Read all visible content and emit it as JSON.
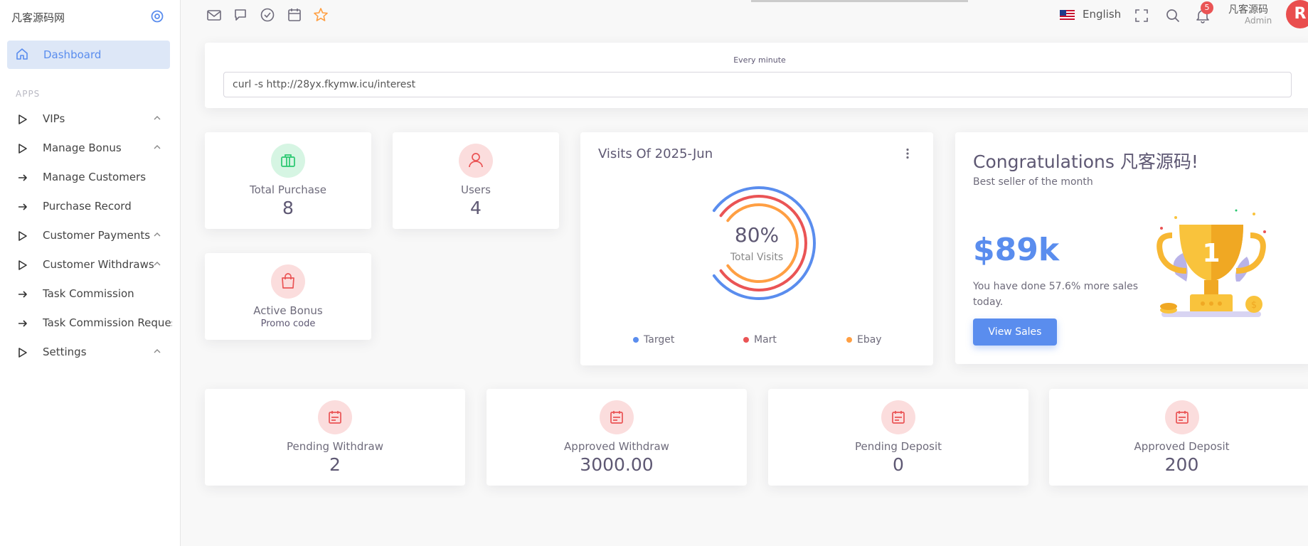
{
  "sidebar": {
    "brand": "凡客源码网",
    "active_item": "Dashboard",
    "section_title": "APPS",
    "items": [
      {
        "label": "VIPs",
        "icon": "play-icon",
        "expandable": true
      },
      {
        "label": "Manage Bonus",
        "icon": "play-icon",
        "expandable": true
      },
      {
        "label": "Manage Customers",
        "icon": "arrow-right-icon",
        "expandable": false
      },
      {
        "label": "Purchase Record",
        "icon": "arrow-right-icon",
        "expandable": false
      },
      {
        "label": "Customer Payments",
        "icon": "play-icon",
        "expandable": true
      },
      {
        "label": "Customer Withdraws",
        "icon": "play-icon",
        "expandable": true
      },
      {
        "label": "Task Commission",
        "icon": "arrow-right-icon",
        "expandable": false
      },
      {
        "label": "Task Commission Request",
        "icon": "arrow-right-icon",
        "expandable": false
      },
      {
        "label": "Settings",
        "icon": "play-icon",
        "expandable": true
      }
    ]
  },
  "topbar": {
    "bookmark_icons": [
      "mail-icon",
      "chat-icon",
      "check-circle-icon",
      "calendar-icon",
      "star-icon"
    ],
    "language": "English",
    "notification_count": "5",
    "user_name": "凡客源码",
    "user_role": "Admin",
    "avatar_letter": "R"
  },
  "cron": {
    "label": "Every minute",
    "command": "curl -s http://28yx.fkymw.icu/interest"
  },
  "stats_top": [
    {
      "label": "Total Purchase",
      "value": "8",
      "icon": "briefcase-icon",
      "color": "#28c76f"
    },
    {
      "label": "Users",
      "value": "4",
      "icon": "user-icon",
      "color": "#ea5455"
    }
  ],
  "active_bonus": {
    "label": "Active Bonus",
    "sub": "Promo code",
    "icon": "shopping-bag-icon"
  },
  "visits": {
    "title": "Visits Of 2025-Jun",
    "percent": "80%",
    "center_label": "Total Visits"
  },
  "chart_data": {
    "type": "pie",
    "title": "Visits Of 2025-Jun",
    "series": [
      {
        "name": "Target",
        "value": 80,
        "color": "#5a8dee"
      },
      {
        "name": "Mart",
        "value": 80,
        "color": "#ea5455"
      },
      {
        "name": "Ebay",
        "value": 80,
        "color": "#ff9f43"
      }
    ]
  },
  "congrats": {
    "title": "Congratulations 凡客源码!",
    "subtitle": "Best seller of the month",
    "amount": "$89k",
    "description": "You have done 57.6% more sales today.",
    "button": "View Sales"
  },
  "stats_bottom": [
    {
      "label": "Pending Withdraw",
      "value": "2"
    },
    {
      "label": "Approved Withdraw",
      "value": "3000.00"
    },
    {
      "label": "Pending Deposit",
      "value": "0"
    },
    {
      "label": "Approved Deposit",
      "value": "200"
    }
  ]
}
